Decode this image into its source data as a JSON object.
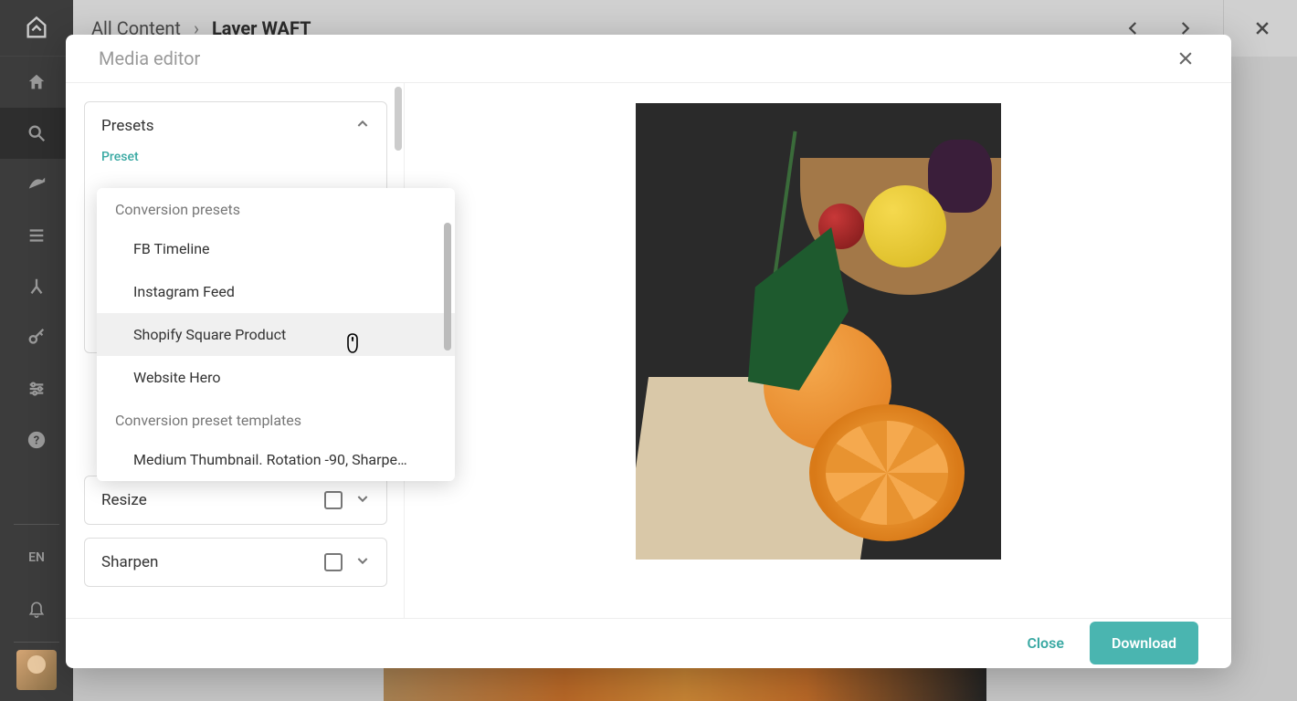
{
  "rail": {
    "lang": "EN"
  },
  "breadcrumb": {
    "root": "All Content",
    "current": "Laver WAFT"
  },
  "modal": {
    "title": "Media editor",
    "close_label": "Close",
    "download_label": "Download"
  },
  "panels": {
    "presets": {
      "title": "Presets",
      "field_label": "Preset"
    },
    "resize": {
      "title": "Resize"
    },
    "sharpen": {
      "title": "Sharpen"
    }
  },
  "dropdown": {
    "group1_label": "Conversion presets",
    "items1": [
      "FB Timeline",
      "Instagram Feed",
      "Shopify Square Product",
      "Website Hero"
    ],
    "group2_label": "Conversion preset templates",
    "items2": [
      "Medium Thumbnail. Rotation -90, Sharpe…"
    ]
  }
}
